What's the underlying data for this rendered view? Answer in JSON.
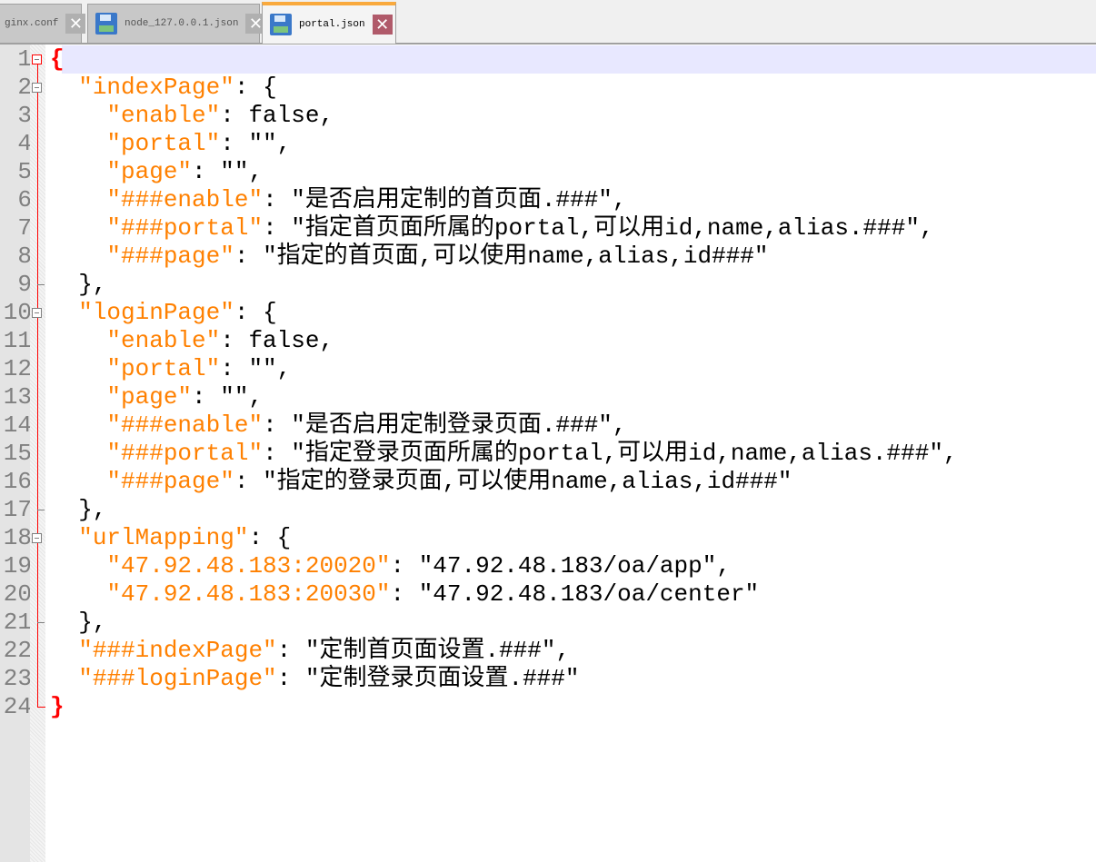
{
  "tabs": [
    {
      "label": "nginx.conf",
      "shown": "ginx.conf",
      "active": false
    },
    {
      "label": "node_127.0.0.1.json",
      "active": false
    },
    {
      "label": "portal.json",
      "active": true
    }
  ],
  "colors": {
    "key": "#ff8000",
    "brace_match": "#ff0000",
    "current_line": "#e8e8ff",
    "active_tab_accent": "#f9a93d"
  },
  "editor": {
    "current_line": 1,
    "lines": [
      [
        [
          "b",
          "{"
        ]
      ],
      [
        [
          "p",
          "  "
        ],
        [
          "k",
          "\"indexPage\""
        ],
        [
          "p",
          ": {"
        ]
      ],
      [
        [
          "p",
          "    "
        ],
        [
          "k",
          "\"enable\""
        ],
        [
          "p",
          ": false,"
        ]
      ],
      [
        [
          "p",
          "    "
        ],
        [
          "k",
          "\"portal\""
        ],
        [
          "p",
          ": \"\","
        ]
      ],
      [
        [
          "p",
          "    "
        ],
        [
          "k",
          "\"page\""
        ],
        [
          "p",
          ": \"\","
        ]
      ],
      [
        [
          "p",
          "    "
        ],
        [
          "k",
          "\"###enable\""
        ],
        [
          "p",
          ": \"是否启用定制的首页面.###\","
        ]
      ],
      [
        [
          "p",
          "    "
        ],
        [
          "k",
          "\"###portal\""
        ],
        [
          "p",
          ": \"指定首页面所属的portal,可以用id,name,alias.###\","
        ]
      ],
      [
        [
          "p",
          "    "
        ],
        [
          "k",
          "\"###page\""
        ],
        [
          "p",
          ": \"指定的首页面,可以使用name,alias,id###\""
        ]
      ],
      [
        [
          "p",
          "  },"
        ]
      ],
      [
        [
          "p",
          "  "
        ],
        [
          "k",
          "\"loginPage\""
        ],
        [
          "p",
          ": {"
        ]
      ],
      [
        [
          "p",
          "    "
        ],
        [
          "k",
          "\"enable\""
        ],
        [
          "p",
          ": false,"
        ]
      ],
      [
        [
          "p",
          "    "
        ],
        [
          "k",
          "\"portal\""
        ],
        [
          "p",
          ": \"\","
        ]
      ],
      [
        [
          "p",
          "    "
        ],
        [
          "k",
          "\"page\""
        ],
        [
          "p",
          ": \"\","
        ]
      ],
      [
        [
          "p",
          "    "
        ],
        [
          "k",
          "\"###enable\""
        ],
        [
          "p",
          ": \"是否启用定制登录页面.###\","
        ]
      ],
      [
        [
          "p",
          "    "
        ],
        [
          "k",
          "\"###portal\""
        ],
        [
          "p",
          ": \"指定登录页面所属的portal,可以用id,name,alias.###\","
        ]
      ],
      [
        [
          "p",
          "    "
        ],
        [
          "k",
          "\"###page\""
        ],
        [
          "p",
          ": \"指定的登录页面,可以使用name,alias,id###\""
        ]
      ],
      [
        [
          "p",
          "  },"
        ]
      ],
      [
        [
          "p",
          "  "
        ],
        [
          "k",
          "\"urlMapping\""
        ],
        [
          "p",
          ": {"
        ]
      ],
      [
        [
          "p",
          "    "
        ],
        [
          "k",
          "\"47.92.48.183:20020\""
        ],
        [
          "p",
          ": \"47.92.48.183/oa/app\","
        ]
      ],
      [
        [
          "p",
          "    "
        ],
        [
          "k",
          "\"47.92.48.183:20030\""
        ],
        [
          "p",
          ": \"47.92.48.183/oa/center\""
        ]
      ],
      [
        [
          "p",
          "  },"
        ]
      ],
      [
        [
          "p",
          "  "
        ],
        [
          "k",
          "\"###indexPage\""
        ],
        [
          "p",
          ": \"定制首页面设置.###\","
        ]
      ],
      [
        [
          "p",
          "  "
        ],
        [
          "k",
          "\"###loginPage\""
        ],
        [
          "p",
          ": \"定制登录页面设置.###\""
        ]
      ],
      [
        [
          "b",
          "}"
        ]
      ]
    ],
    "fold_starts": [
      1,
      2,
      10,
      18
    ],
    "fold_ends": [
      9,
      17,
      21
    ]
  }
}
